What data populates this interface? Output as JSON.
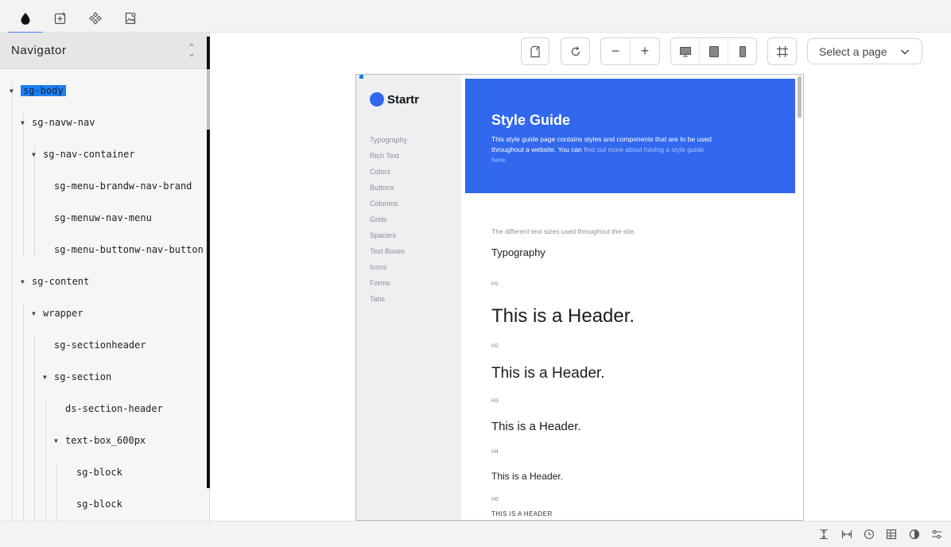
{
  "panel_tabs": [
    {
      "name": "navigator",
      "icon": "drop-icon"
    },
    {
      "name": "add",
      "icon": "add-element-icon"
    },
    {
      "name": "components",
      "icon": "components-icon"
    },
    {
      "name": "assets",
      "icon": "assets-icon"
    }
  ],
  "navigator": {
    "title": "Navigator",
    "tree": [
      {
        "label": "sg-body",
        "level": 0,
        "expandable": true,
        "selected": true
      },
      {
        "label": "sg-navw-nav",
        "level": 1,
        "expandable": true
      },
      {
        "label": "sg-nav-container",
        "level": 2,
        "expandable": true
      },
      {
        "label": "sg-menu-brandw-nav-brand",
        "level": 3,
        "expandable": false
      },
      {
        "label": "sg-menuw-nav-menu",
        "level": 3,
        "expandable": false
      },
      {
        "label": "sg-menu-buttonw-nav-button",
        "level": 3,
        "expandable": false
      },
      {
        "label": "sg-content",
        "level": 1,
        "expandable": true
      },
      {
        "label": "wrapper",
        "level": 2,
        "expandable": true
      },
      {
        "label": "sg-sectionheader",
        "level": 3,
        "expandable": false
      },
      {
        "label": "sg-section",
        "level": 3,
        "expandable": true
      },
      {
        "label": "ds-section-header",
        "level": 4,
        "expandable": false
      },
      {
        "label": "text-box_600px",
        "level": 4,
        "expandable": true
      },
      {
        "label": "sg-block",
        "level": 5,
        "expandable": false
      },
      {
        "label": "sg-block",
        "level": 5,
        "expandable": false
      }
    ]
  },
  "toolbar": {
    "page_select_placeholder": "Select a page",
    "buttons": [
      "export-icon",
      "refresh-icon",
      "zoom-out-icon",
      "zoom-in-icon",
      "desktop-icon",
      "tablet-icon",
      "mobile-icon",
      "grid-icon"
    ]
  },
  "preview": {
    "brand": "Startr",
    "menu": [
      "Typography",
      "Rich Text",
      "Colors",
      "Buttons",
      "Columns",
      "Grids",
      "Spacers",
      "Text Boxes",
      "Icons",
      "Forms",
      "Tabs"
    ],
    "hero": {
      "title": "Style Guide",
      "desc_before": "This style guide page contains styles and components that are to be used throughout a website. You can ",
      "desc_link": "find out more about having a style guide here",
      "desc_after": "."
    },
    "section_desc": "The different text sizes used throughout the site.",
    "section_title": "Typography",
    "headings": [
      {
        "tag": "H1",
        "text": "This is a Header."
      },
      {
        "tag": "H2",
        "text": "This is a Header."
      },
      {
        "tag": "H3",
        "text": "This is a Header."
      },
      {
        "tag": "H4",
        "text": "This is a Header."
      },
      {
        "tag": "H5",
        "text": "THIS IS A HEADER"
      }
    ]
  },
  "statusbar_icons": [
    "height-icon",
    "width-icon",
    "history-icon",
    "table-icon",
    "contrast-icon",
    "settings-icon"
  ],
  "colors": {
    "accent": "#3b82f6",
    "hero": "#3168ee",
    "selection": "#1e7ff0"
  }
}
